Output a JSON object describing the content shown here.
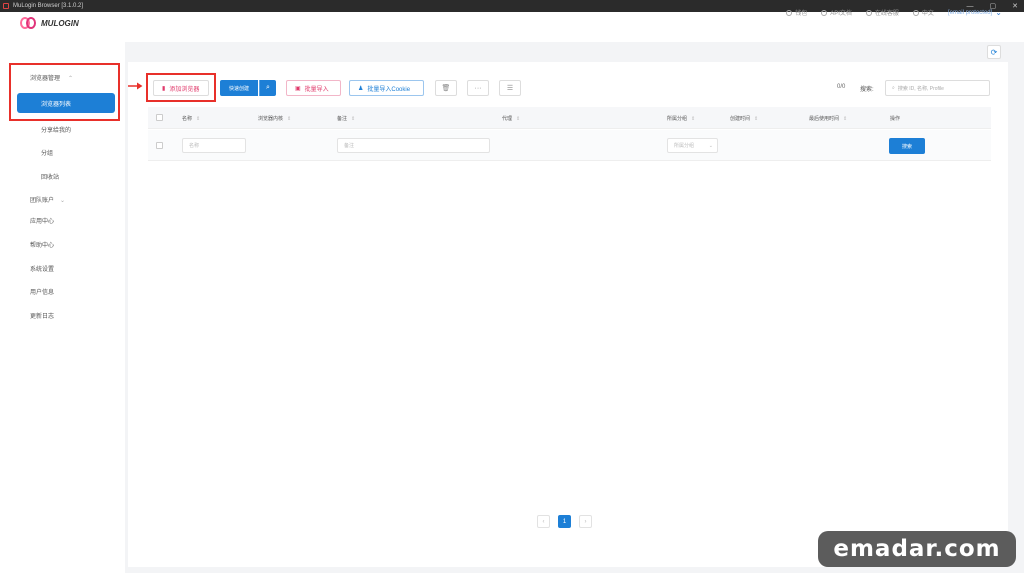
{
  "window": {
    "title": "MuLogin Browser  [3.1.0.2]",
    "controls": [
      "—",
      "▢",
      "✕"
    ]
  },
  "brand": {
    "name": "MULOGIN"
  },
  "topnav": {
    "items": [
      {
        "label": "钱包",
        "icon": "wallet-icon"
      },
      {
        "label": "API文档",
        "icon": "api-doc-icon"
      },
      {
        "label": "在线客服",
        "icon": "support-icon"
      },
      {
        "label": "中文",
        "icon": "language-icon"
      }
    ],
    "account": "[email protected]"
  },
  "sidebar": {
    "group_label": "浏览器管理",
    "active_label": "浏览器列表",
    "items": [
      "分享给我的",
      "分组",
      "回收站",
      "团队账户",
      "应用中心",
      "帮助中心",
      "系统设置",
      "用户信息",
      "更新日志"
    ]
  },
  "toolbar": {
    "add_label": "添加浏览器",
    "quick_label": "快速创建",
    "import_label": "批量导入",
    "cookie_label": "批量导入Cookie",
    "more_label": "···",
    "count": "0/0",
    "search_label": "搜索:",
    "search_placeholder": "搜索 ID, 名称, Profile"
  },
  "table": {
    "columns": [
      "名称",
      "浏览器内核",
      "备注",
      "代理",
      "所属分组",
      "创建时间",
      "最后使用时间",
      "操作"
    ],
    "filter_row": {
      "name_placeholder": "名称",
      "remark_placeholder": "备注",
      "group_placeholder": "所属分组",
      "search_button": "搜索"
    }
  },
  "pagination": {
    "prev": "‹",
    "current": "1",
    "next": "›"
  },
  "watermark": "emadar.com",
  "colors": {
    "accent": "#1d7fd6",
    "highlight": "#e8302a",
    "pink": "#e03a6b"
  }
}
